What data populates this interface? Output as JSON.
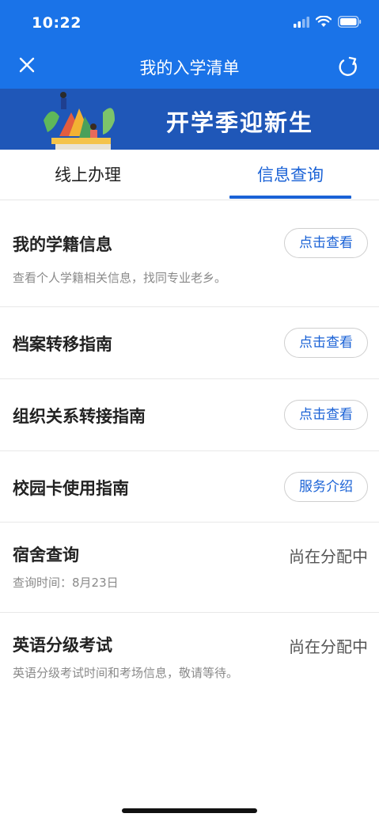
{
  "status_bar": {
    "time": "10:22"
  },
  "nav": {
    "title": "我的入学清单"
  },
  "banner": {
    "text": "开学季迎新生"
  },
  "tabs": [
    {
      "label": "线上办理",
      "active": false
    },
    {
      "label": "信息查询",
      "active": true
    }
  ],
  "items": [
    {
      "title": "我的学籍信息",
      "subtitle": "查看个人学籍相关信息，找同专业老乡。",
      "action": "点击查看"
    },
    {
      "title": "档案转移指南",
      "action": "点击查看"
    },
    {
      "title": "组织关系转接指南",
      "action": "点击查看"
    },
    {
      "title": "校园卡使用指南",
      "action": "服务介绍"
    },
    {
      "title": "宿舍查询",
      "subtitle": "查询时间：8月23日",
      "status": "尚在分配中"
    },
    {
      "title": "英语分级考试",
      "subtitle": "英语分级考试时间和考场信息，敬请等待。",
      "status": "尚在分配中"
    }
  ],
  "colors": {
    "header": "#1a73e8",
    "banner": "#1f57b8",
    "accent": "#1a62d6"
  },
  "icons": {
    "close": "close-icon",
    "refresh": "refresh-icon",
    "signal": "signal-icon",
    "wifi": "wifi-icon",
    "battery": "battery-icon"
  }
}
